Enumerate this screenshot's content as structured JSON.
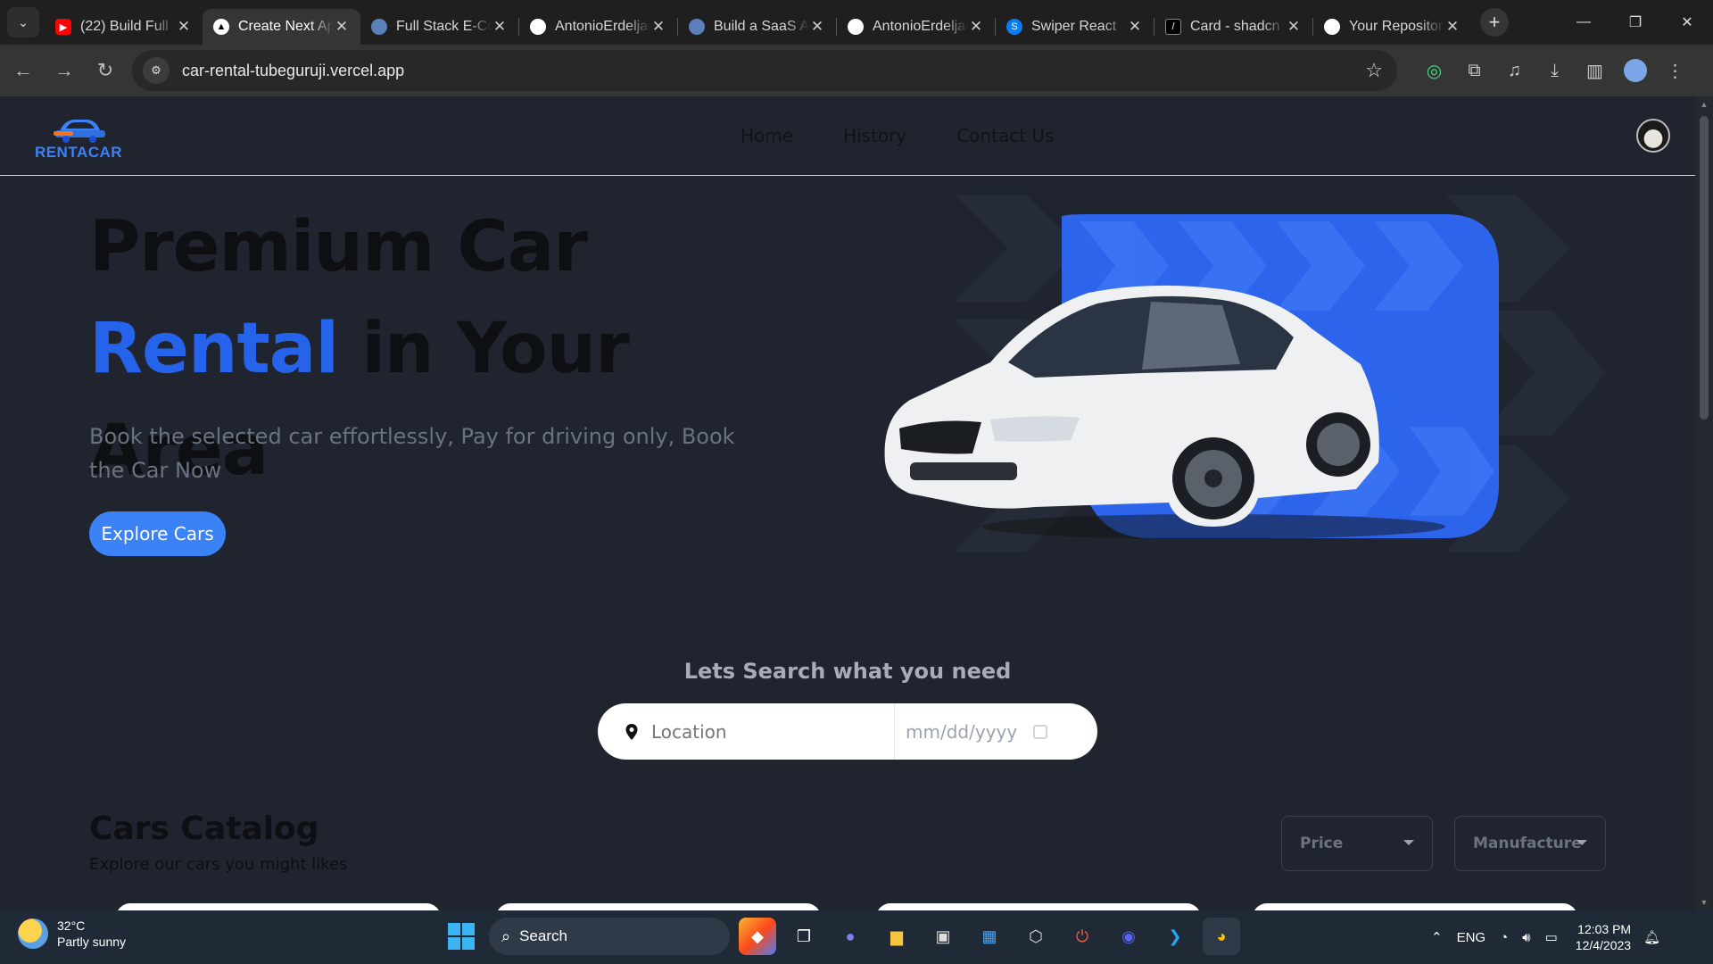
{
  "browser": {
    "tabs": [
      {
        "title": "(22) Build Full",
        "icon": "youtube-icon",
        "color": "#ff0000",
        "active": false
      },
      {
        "title": "Create Next App",
        "icon": "vercel-icon",
        "color": "#000000",
        "active": true
      },
      {
        "title": "Full Stack E-Commerce",
        "icon": "globe-icon",
        "color": "#5b7fb8",
        "active": false
      },
      {
        "title": "AntonioErdeljac",
        "icon": "github-icon",
        "color": "#ffffff",
        "active": false
      },
      {
        "title": "Build a SaaS AI",
        "icon": "globe-icon",
        "color": "#5b7fb8",
        "active": false
      },
      {
        "title": "AntonioErdeljac",
        "icon": "github-icon",
        "color": "#ffffff",
        "active": false
      },
      {
        "title": "Swiper React",
        "icon": "swiper-icon",
        "color": "#0a7cf4",
        "active": false
      },
      {
        "title": "Card - shadcn",
        "icon": "shadcn-icon",
        "color": "#ffffff",
        "active": false
      },
      {
        "title": "Your Repositories",
        "icon": "github-icon",
        "color": "#ffffff",
        "active": false
      }
    ],
    "url": "car-rental-tubeguruji.vercel.app"
  },
  "site": {
    "logo_text": "RENTACAR",
    "nav": [
      "Home",
      "History",
      "Contact Us"
    ],
    "hero": {
      "title_part1": "Premium Car ",
      "title_accent": "Rental",
      "title_part2": " in Your Area",
      "subtitle": "Book the selected car effortlessly, Pay for driving only, Book the Car Now",
      "cta": "Explore Cars"
    },
    "search": {
      "heading": "Lets Search what you need",
      "location_placeholder": "Location",
      "date_placeholder": "mm/dd/yyyy"
    },
    "catalog": {
      "title": "Cars Catalog",
      "subtitle": "Explore our cars you might likes",
      "filters": [
        "Price",
        "Manufacturer"
      ]
    },
    "colors": {
      "accent": "#2563eb",
      "button": "#3b82f6",
      "background": "#1f242e"
    }
  },
  "taskbar": {
    "weather_temp": "32°C",
    "weather_desc": "Partly sunny",
    "search_label": "Search",
    "language": "ENG",
    "time": "12:03 PM",
    "date": "12/4/2023"
  }
}
